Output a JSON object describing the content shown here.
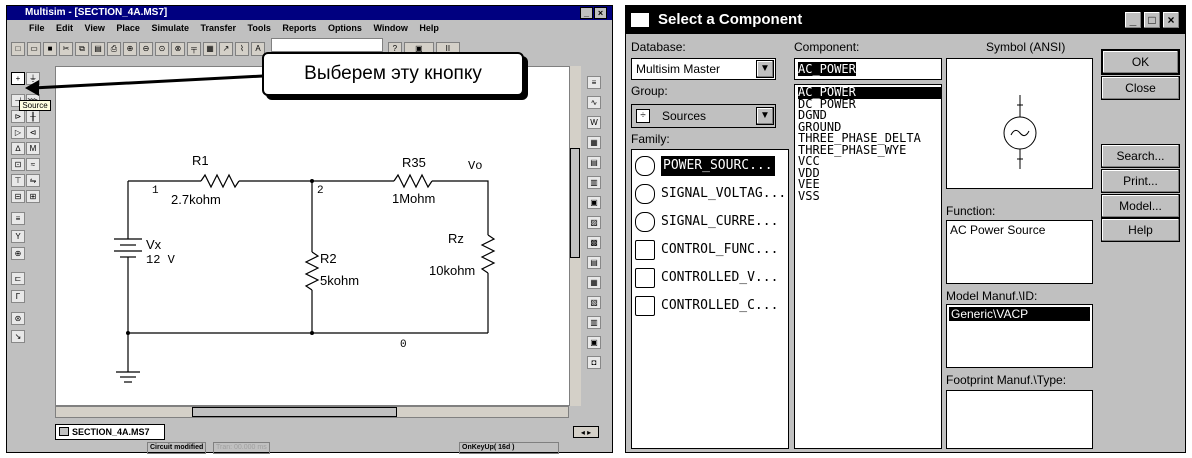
{
  "multisim": {
    "title": "Multisim - [SECTION_4A.MS7]",
    "menu": [
      "File",
      "Edit",
      "View",
      "Place",
      "Simulate",
      "Transfer",
      "Tools",
      "Reports",
      "Options",
      "Window",
      "Help"
    ],
    "callout": "Выберем эту кнопку",
    "tooltip": "Source",
    "tab": "SECTION_4A.MS7",
    "status": [
      "Circuit modified",
      "Tran: 00.000 ms",
      "OnKeyUp( 16d )"
    ],
    "schematic": {
      "R1": "R1",
      "R1_value": "2.7kohm",
      "R35": "R35",
      "R35_value": "1Mohm",
      "R2": "R2",
      "R2_value": "5kohm",
      "Rz": "Rz",
      "Rz_value": "10kohm",
      "Vx": "Vx",
      "Vx_value": "12 V",
      "Vo": "Vo",
      "node1": "1",
      "node2": "2",
      "node0": "0"
    }
  },
  "dialog": {
    "title": "Select a Component",
    "database_label": "Database:",
    "database_value": "Multisim Master",
    "group_label": "Group:",
    "group_value": "Sources",
    "family_label": "Family:",
    "families": [
      "POWER_SOURC...",
      "SIGNAL_VOLTAG...",
      "SIGNAL_CURRE...",
      "CONTROL_FUNC...",
      "CONTROLLED_V...",
      "CONTROLLED_C..."
    ],
    "component_label": "Component:",
    "component_value": "AC_POWER",
    "components": [
      "AC_POWER",
      "DC_POWER",
      "DGND",
      "GROUND",
      "THREE_PHASE_DELTA",
      "THREE_PHASE_WYE",
      "VCC",
      "VDD",
      "VEE",
      "VSS"
    ],
    "symbol_label": "Symbol (ANSI)",
    "function_label": "Function:",
    "function_value": "AC Power Source",
    "model_label": "Model Manuf.\\ID:",
    "model_value": "Generic\\VACP",
    "footprint_label": "Footprint Manuf.\\Type:",
    "buttons": {
      "ok": "OK",
      "close": "Close",
      "search": "Search...",
      "print": "Print...",
      "model": "Model...",
      "help": "Help"
    }
  }
}
